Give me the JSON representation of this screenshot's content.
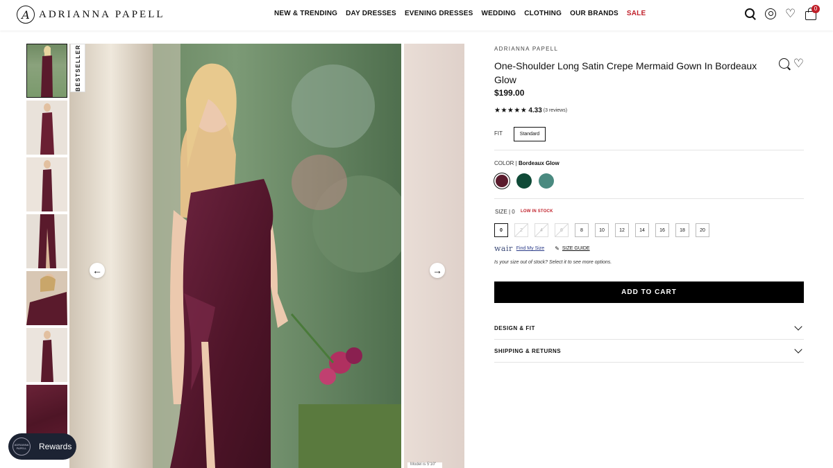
{
  "header": {
    "logo_mark": "A",
    "logo_text": "ADRIANNA PAPELL",
    "nav": [
      "NEW & TRENDING",
      "DAY DRESSES",
      "EVENING DRESSES",
      "WEDDING",
      "CLOTHING",
      "OUR BRANDS",
      "SALE"
    ],
    "cart_count": "0",
    "icons": [
      "search-icon",
      "account-icon",
      "heart-icon",
      "bag-icon"
    ]
  },
  "gallery": {
    "badge": "BESTSELLER",
    "prev_arrow": "←",
    "next_arrow": "→",
    "model_tag": "Model is 5'10\"",
    "thumbnail_count": 7
  },
  "rewards": {
    "logo_text": "ADRIANNA PAPELL",
    "label": "Rewards"
  },
  "product": {
    "brand": "ADRIANNA PAPELL",
    "title": "One-Shoulder Long Satin Crepe Mermaid Gown In Bordeaux Glow",
    "price": "$199.00",
    "stars": "★★★★★",
    "rating": "4.33",
    "reviews": "(3 reviews)",
    "fit_label": "FIT",
    "fit_value": "Standard",
    "color_label": "COLOR |",
    "color_value": "Bordeaux Glow",
    "colors": [
      "#5a1a2c",
      "#0f4a37",
      "#4a8a80"
    ],
    "size_label": "SIZE | 0",
    "low_stock": "LOW IN STOCK",
    "sizes": [
      "0",
      "2",
      "4",
      "6",
      "8",
      "10",
      "12",
      "14",
      "16",
      "18",
      "20"
    ],
    "out_of_stock_sizes": [
      "2",
      "4",
      "6"
    ],
    "selected_size": "0",
    "wair": "wair",
    "find_my_size": "Find My Size",
    "size_guide": "SIZE GUIDE",
    "stock_note": "Is your size out of stock? Select it to see more options.",
    "add_to_cart": "ADD TO CART",
    "accordions": [
      "DESIGN & FIT",
      "SHIPPING & RETURNS"
    ]
  }
}
